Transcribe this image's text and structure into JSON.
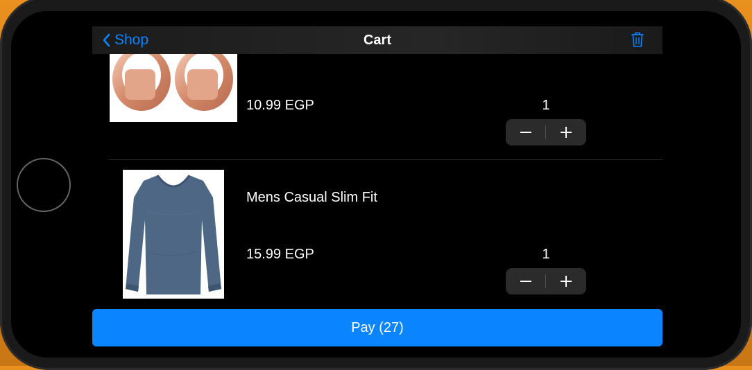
{
  "nav": {
    "back_label": "Shop",
    "title": "Cart",
    "accent": "#0a84ff",
    "delete_icon": "trash-icon"
  },
  "cart": {
    "items": [
      {
        "name": "",
        "price": "10.99 EGP",
        "quantity": "1",
        "image": "rose-gold-rings"
      },
      {
        "name": "Mens Casual Slim Fit",
        "price": "15.99 EGP",
        "quantity": "1",
        "image": "blue-long-sleeve-shirt"
      }
    ]
  },
  "pay": {
    "label": "Pay (27)"
  }
}
